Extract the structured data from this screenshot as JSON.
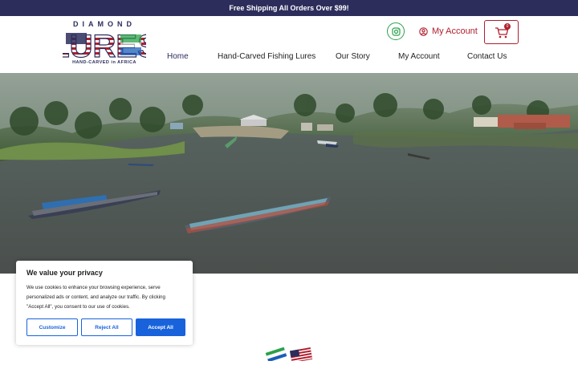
{
  "topbar": {
    "text": "Free Shipping All Orders Over $99!"
  },
  "logo": {
    "top_text": "DIAMOND",
    "main_text": "LURES",
    "tagline": "HAND-CARVED in AFRICA"
  },
  "nav": {
    "items": [
      {
        "label": "Home",
        "active": true
      },
      {
        "label": "Hand-Carved Fishing Lures"
      },
      {
        "label": "Our Story"
      },
      {
        "label": "My Account"
      },
      {
        "label": "Contact Us"
      }
    ]
  },
  "header_actions": {
    "account_label": "My Account",
    "cart_count": "0"
  },
  "cookie_banner": {
    "title": "We value your privacy",
    "body": "We use cookies to enhance your browsing experience, serve personalized ads or content, and analyze our traffic. By clicking \"Accept All\", you consent to our use of cookies.",
    "customize_label": "Customize",
    "reject_label": "Reject All",
    "accept_label": "Accept All"
  },
  "colors": {
    "navy": "#2c2d5b",
    "red": "#b01e2d",
    "green": "#2aa14a",
    "cookie_blue": "#1863dc"
  }
}
